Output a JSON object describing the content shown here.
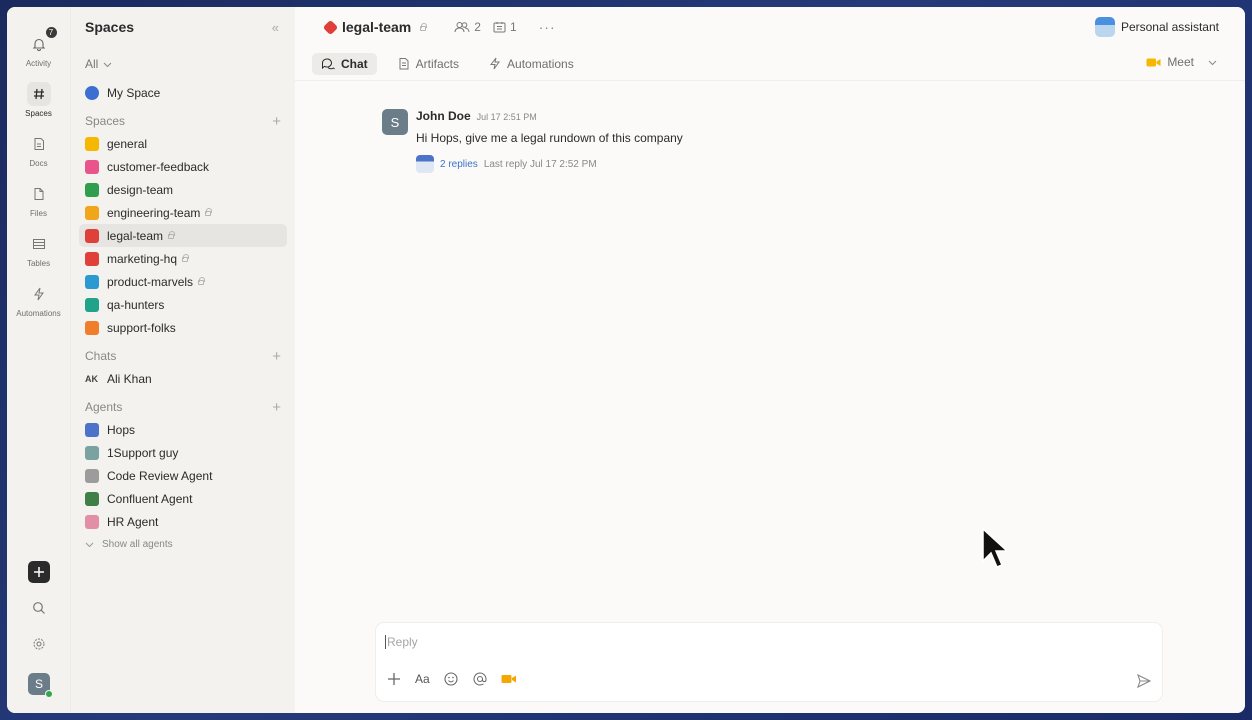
{
  "rail": {
    "items": [
      {
        "label": "Activity",
        "icon": "bell-icon",
        "badge": "7"
      },
      {
        "label": "Spaces",
        "icon": "hash-icon"
      },
      {
        "label": "Docs",
        "icon": "doc-icon"
      },
      {
        "label": "Files",
        "icon": "file-icon"
      },
      {
        "label": "Tables",
        "icon": "table-icon"
      },
      {
        "label": "Automations",
        "icon": "bolt-icon"
      }
    ],
    "user_initial": "S"
  },
  "sidebar": {
    "title": "Spaces",
    "filter": "All",
    "my_space": "My Space",
    "spaces_header": "Spaces",
    "spaces": [
      {
        "label": "general",
        "color": "#f5b700",
        "private": false
      },
      {
        "label": "customer-feedback",
        "color": "#e9558b",
        "private": false
      },
      {
        "label": "design-team",
        "color": "#2f9e4f",
        "private": false
      },
      {
        "label": "engineering-team",
        "color": "#f1a51a",
        "private": true
      },
      {
        "label": "legal-team",
        "color": "#e0403a",
        "private": true
      },
      {
        "label": "marketing-hq",
        "color": "#e0403a",
        "private": true
      },
      {
        "label": "product-marvels",
        "color": "#2b9ad0",
        "private": true
      },
      {
        "label": "qa-hunters",
        "color": "#21a38a",
        "private": false
      },
      {
        "label": "support-folks",
        "color": "#f07d2a",
        "private": false
      }
    ],
    "chats_header": "Chats",
    "chats": [
      {
        "initials": "AK",
        "label": "Ali Khan"
      }
    ],
    "agents_header": "Agents",
    "agents": [
      {
        "label": "Hops",
        "color": "#4a73c9"
      },
      {
        "label": "1Support guy",
        "color": "#7aa2a0"
      },
      {
        "label": "Code Review Agent",
        "color": "#9c9c9c"
      },
      {
        "label": "Confluent Agent",
        "color": "#3f7f48"
      },
      {
        "label": "HR Agent",
        "color": "#e28ea6"
      }
    ],
    "show_all": "Show all agents"
  },
  "header": {
    "channel": "legal-team",
    "members_count": "2",
    "files_count": "1",
    "more": "···",
    "assistant": "Personal assistant"
  },
  "tabs": [
    {
      "label": "Chat",
      "active": true
    },
    {
      "label": "Artifacts",
      "active": false
    },
    {
      "label": "Automations",
      "active": false
    }
  ],
  "meet_label": "Meet",
  "message": {
    "avatar": "S",
    "author": "John Doe",
    "time": "Jul 17 2:51 PM",
    "text": "Hi Hops, give me a legal rundown of this company",
    "replies": "2 replies",
    "last_reply": "Last reply Jul 17 2:52 PM"
  },
  "composer": {
    "placeholder": "Reply",
    "format_label": "Aa"
  }
}
